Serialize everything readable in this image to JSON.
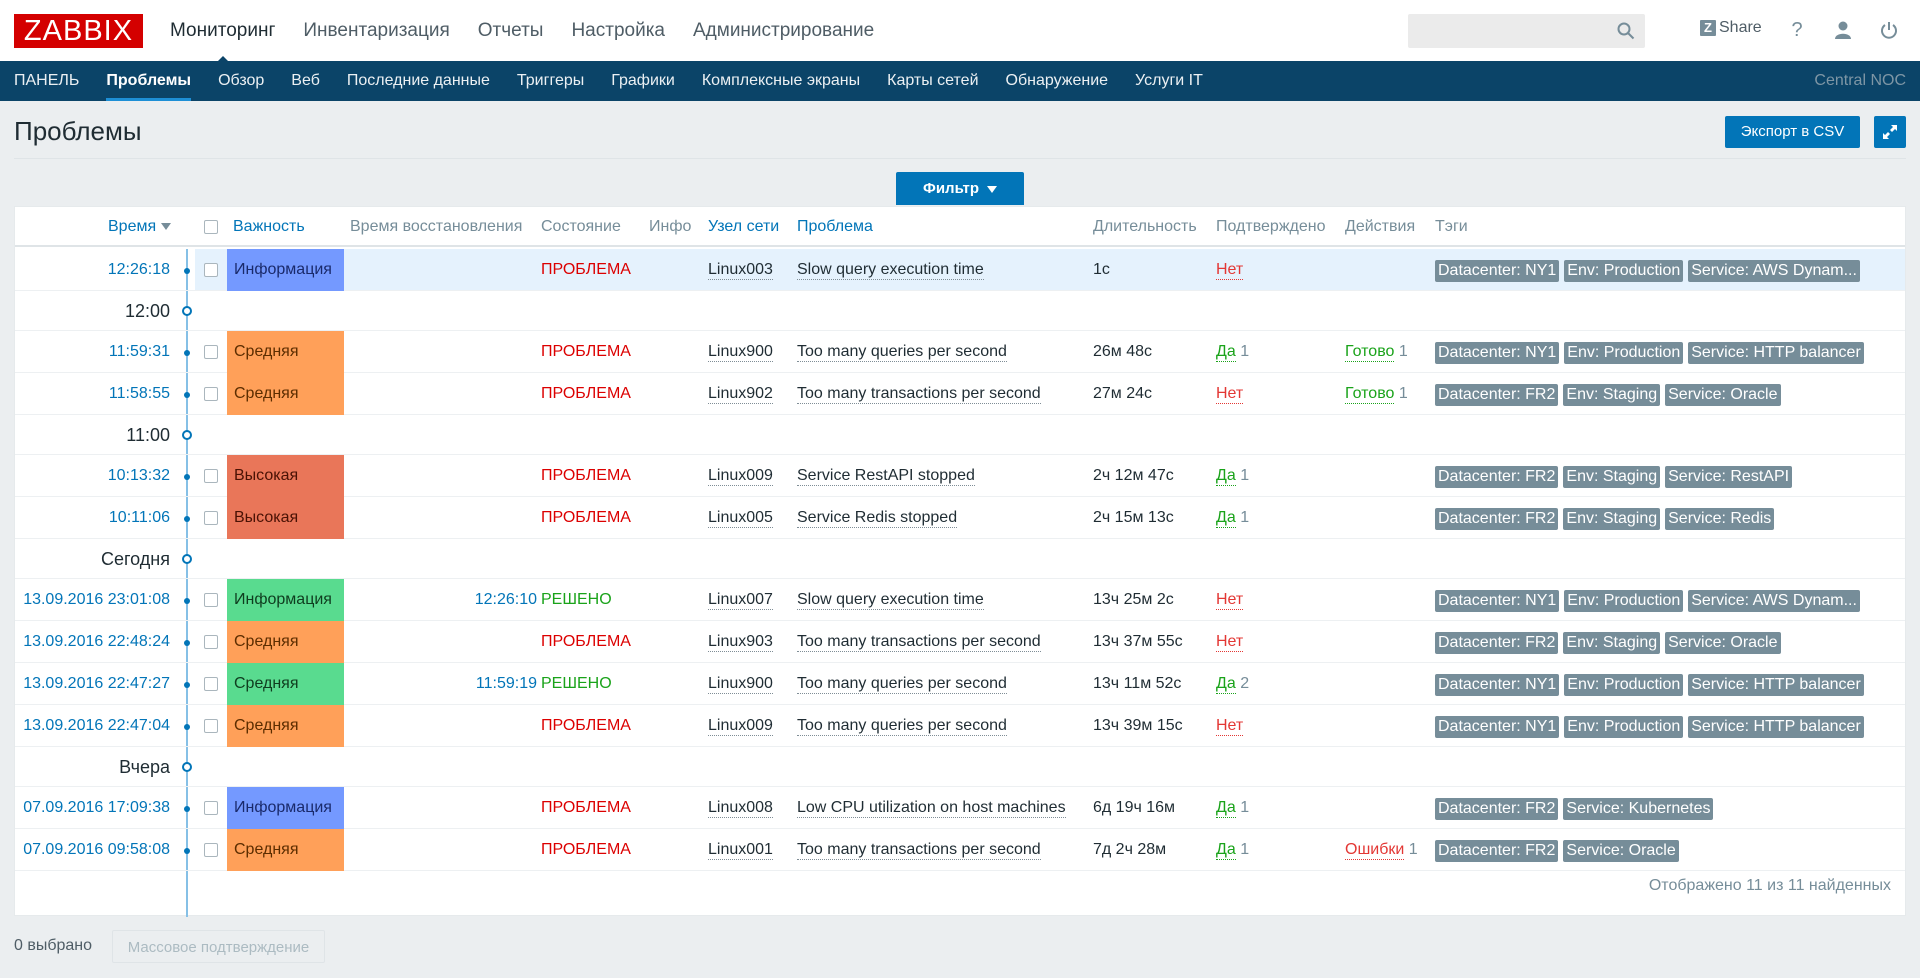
{
  "header": {
    "logo": "ZABBIX",
    "main_menu": [
      {
        "label": "Мониторинг",
        "active": true
      },
      {
        "label": "Инвентаризация",
        "active": false
      },
      {
        "label": "Отчеты",
        "active": false
      },
      {
        "label": "Настройка",
        "active": false
      },
      {
        "label": "Администрирование",
        "active": false
      }
    ],
    "search_placeholder": "",
    "share_label": "Share",
    "share_badge": "Z",
    "help_glyph": "?"
  },
  "subnav": {
    "items": [
      {
        "label": "ПАНЕЛЬ",
        "active": false
      },
      {
        "label": "Проблемы",
        "active": true
      },
      {
        "label": "Обзор",
        "active": false
      },
      {
        "label": "Веб",
        "active": false
      },
      {
        "label": "Последние данные",
        "active": false
      },
      {
        "label": "Триггеры",
        "active": false
      },
      {
        "label": "Графики",
        "active": false
      },
      {
        "label": "Комплексные экраны",
        "active": false
      },
      {
        "label": "Карты сетей",
        "active": false
      },
      {
        "label": "Обнаружение",
        "active": false
      },
      {
        "label": "Услуги IT",
        "active": false
      }
    ],
    "server_name": "Central NOC"
  },
  "page": {
    "title": "Проблемы",
    "export_label": "Экспорт в CSV",
    "filter_label": "Фильтр"
  },
  "table": {
    "columns": {
      "time": "Время",
      "severity": "Важность",
      "recovery_time": "Время восстановления",
      "status": "Состояние",
      "info": "Инфо",
      "host": "Узел сети",
      "problem": "Проблема",
      "duration": "Длительность",
      "ack": "Подтверждено",
      "actions": "Действия",
      "tags": "Тэги"
    },
    "groups": {
      "g1200": "12:00",
      "g1100": "11:00",
      "today": "Сегодня",
      "yesterday": "Вчера"
    },
    "rows": [
      {
        "time": "12:26:18",
        "severity": "Информация",
        "severity_color": "#7499ff",
        "recovery": "",
        "status": "ПРОБЛЕМА",
        "host": "Linux003",
        "problem": "Slow query execution time",
        "duration": "1с",
        "ack": "Нет",
        "ack_count": "",
        "action": "",
        "action_count": "",
        "tags": [
          "Datacenter: NY1",
          "Env: Production",
          "Service: AWS Dynam..."
        ]
      },
      {
        "time": "11:59:31",
        "severity": "Средняя",
        "severity_color": "#ffa059",
        "recovery": "",
        "status": "ПРОБЛЕМА",
        "host": "Linux900",
        "problem": "Too many queries per second",
        "duration": "26м 48с",
        "ack": "Да",
        "ack_count": "1",
        "action": "Готово",
        "action_count": "1",
        "tags": [
          "Datacenter: NY1",
          "Env: Production",
          "Service: HTTP balancer"
        ]
      },
      {
        "time": "11:58:55",
        "severity": "Средняя",
        "severity_color": "#ffa059",
        "recovery": "",
        "status": "ПРОБЛЕМА",
        "host": "Linux902",
        "problem": "Too many transactions per second",
        "duration": "27м 24с",
        "ack": "Нет",
        "ack_count": "",
        "action": "Готово",
        "action_count": "1",
        "tags": [
          "Datacenter: FR2",
          "Env: Staging",
          "Service: Oracle"
        ]
      },
      {
        "time": "10:13:32",
        "severity": "Высокая",
        "severity_color": "#e97659",
        "recovery": "",
        "status": "ПРОБЛЕМА",
        "host": "Linux009",
        "problem": "Service RestAPI stopped",
        "duration": "2ч 12м 47с",
        "ack": "Да",
        "ack_count": "1",
        "action": "",
        "action_count": "",
        "tags": [
          "Datacenter: FR2",
          "Env: Staging",
          "Service: RestAPI"
        ]
      },
      {
        "time": "10:11:06",
        "severity": "Высокая",
        "severity_color": "#e97659",
        "recovery": "",
        "status": "ПРОБЛЕМА",
        "host": "Linux005",
        "problem": "Service Redis stopped",
        "duration": "2ч 15м 13с",
        "ack": "Да",
        "ack_count": "1",
        "action": "",
        "action_count": "",
        "tags": [
          "Datacenter: FR2",
          "Env: Staging",
          "Service: Redis"
        ]
      },
      {
        "time": "13.09.2016 23:01:08",
        "severity": "Информация",
        "severity_color": "#59db8f",
        "recovery": "12:26:10",
        "status": "РЕШЕНО",
        "host": "Linux007",
        "problem": "Slow query execution time",
        "duration": "13ч 25м 2с",
        "ack": "Нет",
        "ack_count": "",
        "action": "",
        "action_count": "",
        "tags": [
          "Datacenter: NY1",
          "Env: Production",
          "Service: AWS Dynam..."
        ]
      },
      {
        "time": "13.09.2016 22:48:24",
        "severity": "Средняя",
        "severity_color": "#ffa059",
        "recovery": "",
        "status": "ПРОБЛЕМА",
        "host": "Linux903",
        "problem": "Too many transactions per second",
        "duration": "13ч 37м 55с",
        "ack": "Нет",
        "ack_count": "",
        "action": "",
        "action_count": "",
        "tags": [
          "Datacenter: FR2",
          "Env: Staging",
          "Service: Oracle"
        ]
      },
      {
        "time": "13.09.2016 22:47:27",
        "severity": "Средняя",
        "severity_color": "#59db8f",
        "recovery": "11:59:19",
        "status": "РЕШЕНО",
        "host": "Linux900",
        "problem": "Too many queries per second",
        "duration": "13ч 11м 52с",
        "ack": "Да",
        "ack_count": "2",
        "action": "",
        "action_count": "",
        "tags": [
          "Datacenter: NY1",
          "Env: Production",
          "Service: HTTP balancer"
        ]
      },
      {
        "time": "13.09.2016 22:47:04",
        "severity": "Средняя",
        "severity_color": "#ffa059",
        "recovery": "",
        "status": "ПРОБЛЕМА",
        "host": "Linux009",
        "problem": "Too many queries per second",
        "duration": "13ч 39м 15с",
        "ack": "Нет",
        "ack_count": "",
        "action": "",
        "action_count": "",
        "tags": [
          "Datacenter: NY1",
          "Env: Production",
          "Service: HTTP balancer"
        ]
      },
      {
        "time": "07.09.2016 17:09:38",
        "severity": "Информация",
        "severity_color": "#7499ff",
        "recovery": "",
        "status": "ПРОБЛЕМА",
        "host": "Linux008",
        "problem": "Low CPU utilization on host machines",
        "duration": "6д 19ч 16м",
        "ack": "Да",
        "ack_count": "1",
        "action": "",
        "action_count": "",
        "tags": [
          "Datacenter: FR2",
          "Service: Kubernetes"
        ]
      },
      {
        "time": "07.09.2016 09:58:08",
        "severity": "Средняя",
        "severity_color": "#ffa059",
        "recovery": "",
        "status": "ПРОБЛЕМА",
        "host": "Linux001",
        "problem": "Too many transactions per second",
        "duration": "7д 2ч 28м",
        "ack": "Да",
        "ack_count": "1",
        "action": "Ошибки",
        "action_count": "1",
        "tags": [
          "Datacenter: FR2",
          "Service: Oracle"
        ]
      }
    ],
    "footer": "Отображено 11 из 11 найденных"
  },
  "bottom": {
    "selected": "0 выбрано",
    "mass_ack_label": "Массовое подтверждение"
  },
  "colors": {
    "problem": "#dc0000",
    "resolved": "#1aa31a",
    "ack_yes": "#1aa31a",
    "ack_no": "#e33734",
    "action_ok": "#1aa31a",
    "action_fail": "#e33734",
    "link": "#0275b8",
    "nav_bg": "#0b4468",
    "tag_bg": "#768d99"
  }
}
